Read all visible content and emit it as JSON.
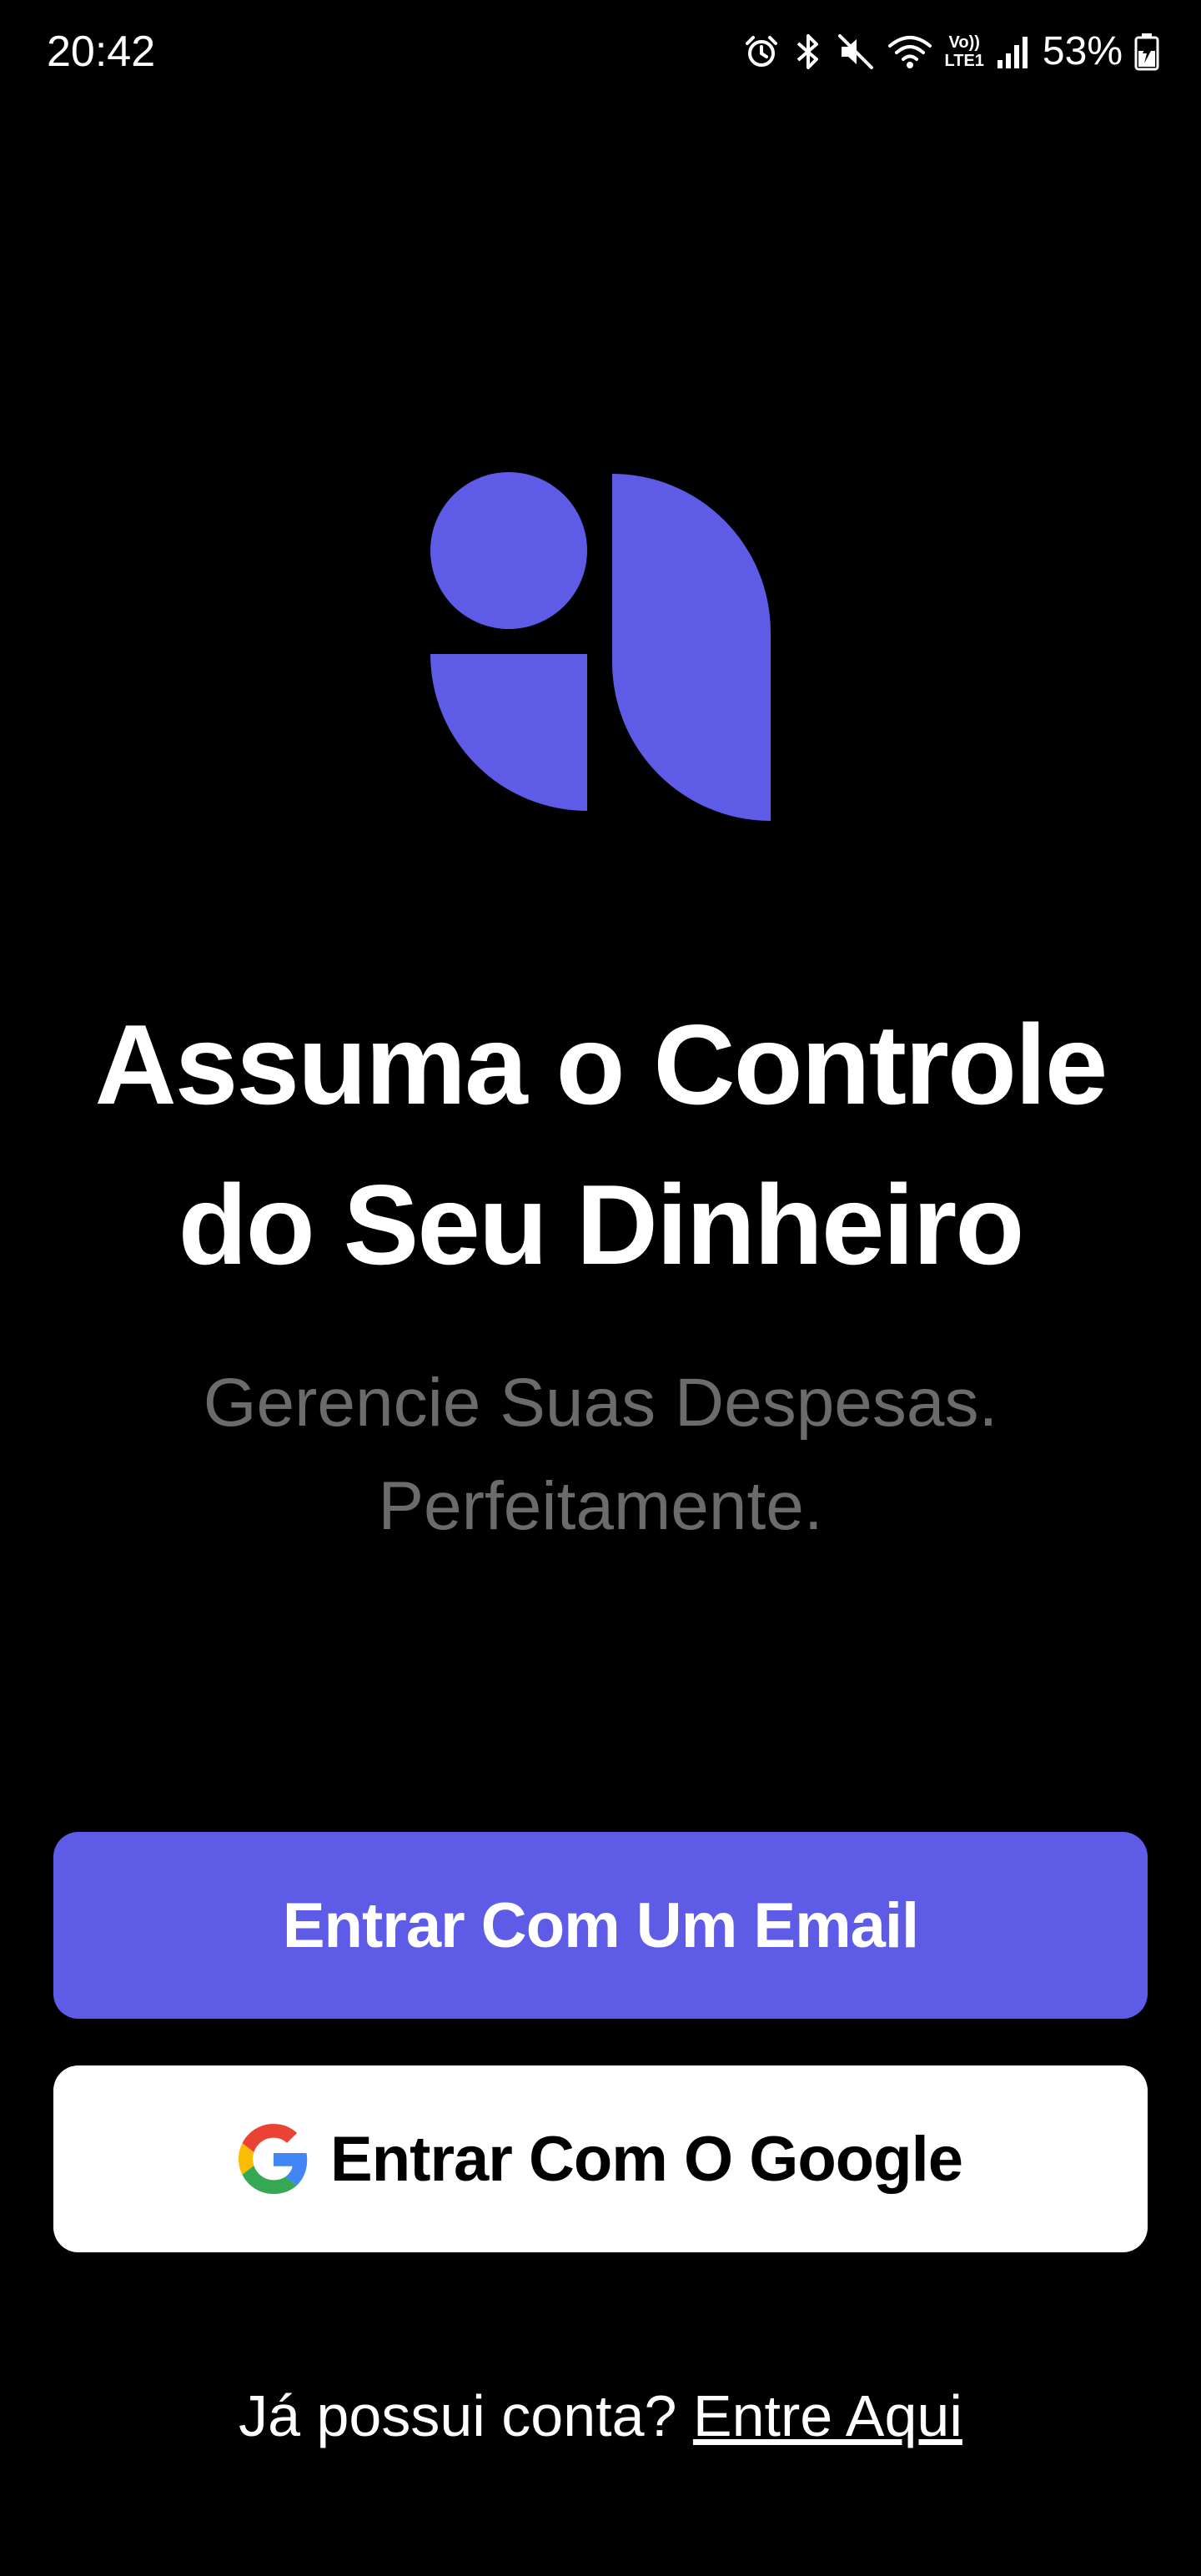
{
  "status_bar": {
    "time": "20:42",
    "lte_top": "Vo))",
    "lte_bottom": "LTE1",
    "battery_percent": "53%",
    "icons": [
      "alarm-icon",
      "bluetooth-icon",
      "mute-icon",
      "wifi-icon",
      "lte-icon",
      "signal-icon",
      "battery-charging-icon"
    ]
  },
  "brand": {
    "accent_color": "#5e5ce6",
    "logo_icon": "app-logo-icon"
  },
  "hero": {
    "title_line1": "Assuma o Controle",
    "title_line2": "do Seu Dinheiro",
    "subtitle_line1": "Gerencie Suas Despesas.",
    "subtitle_line2": "Perfeitamente."
  },
  "actions": {
    "email_button_label": "Entrar Com Um Email",
    "google_button_label": "Entrar Com O Google",
    "google_icon": "google-icon"
  },
  "footer": {
    "prompt_text": "Já possui conta? ",
    "login_link_label": "Entre Aqui"
  },
  "colors": {
    "background": "#000000",
    "subtitle": "#6b6b6b",
    "google_button_bg": "#ffffff"
  }
}
